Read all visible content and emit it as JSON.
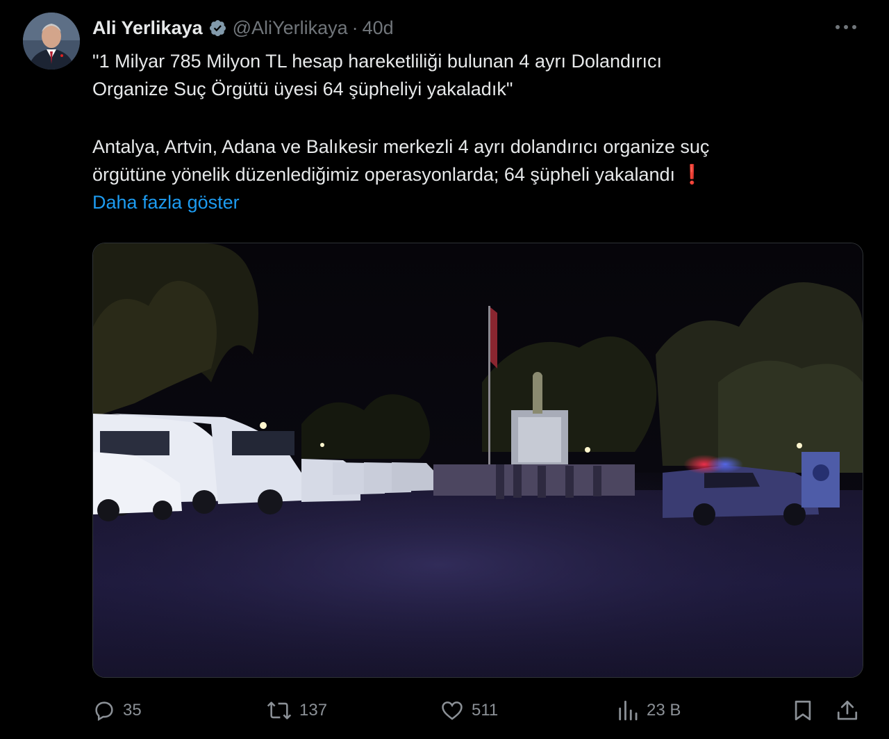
{
  "author": {
    "display_name": "Ali Yerlikaya",
    "handle": "@AliYerlikaya",
    "separator": "·",
    "time": "40d",
    "verified": true
  },
  "tweet": {
    "line1": "\"1 Milyar 785 Milyon TL hesap hareketliliği bulunan 4 ayrı Dolandırıcı",
    "line2": "Organize Suç Örgütü üyesi 64 şüpheliyi yakaladık\"",
    "line3": "Antalya, Artvin, Adana ve Balıkesir merkezli 4 ayrı dolandırıcı organize suç",
    "line4": "örgütüne yönelik düzenlediğimiz operasyonlarda; 64 şüpheli yakalandı",
    "alert_emoji": "❗",
    "show_more": "Daha fazla göster"
  },
  "media": {
    "icon": "photo-night-square-police-lineup"
  },
  "actions": {
    "replies": "35",
    "reposts": "137",
    "likes": "511",
    "views": "23 B"
  },
  "colors": {
    "background": "#000000",
    "text": "#e7e9ea",
    "muted": "#71767b",
    "link": "#1d9bf0",
    "verified": "#829aab",
    "alert": "#e0245e"
  }
}
